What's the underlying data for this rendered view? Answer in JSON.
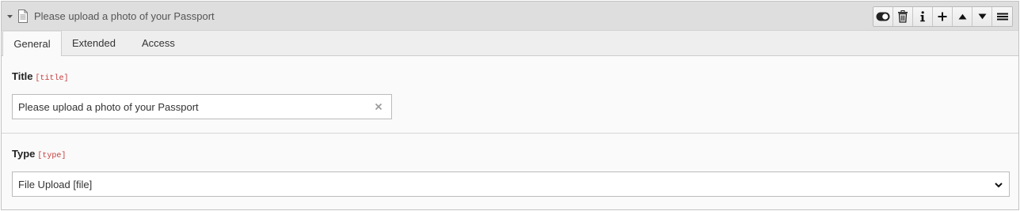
{
  "header": {
    "title": "Please upload a photo of your Passport",
    "toolbar_icons": [
      "toggle-icon",
      "trash-icon",
      "info-icon",
      "plus-icon",
      "arrow-up-icon",
      "arrow-down-icon",
      "drag-handle-icon"
    ]
  },
  "tabs": [
    {
      "label": "General",
      "active": true
    },
    {
      "label": "Extended",
      "active": false
    },
    {
      "label": "Access",
      "active": false
    }
  ],
  "fields": {
    "title": {
      "label": "Title",
      "key": "[title]",
      "value": "Please upload a photo of your Passport"
    },
    "type": {
      "label": "Type",
      "key": "[type]",
      "value": "File Upload [file]"
    }
  },
  "colors": {
    "header_bg": "#dedede",
    "tabs_bg": "#eeeeee",
    "field_key": "#c83c3c"
  }
}
